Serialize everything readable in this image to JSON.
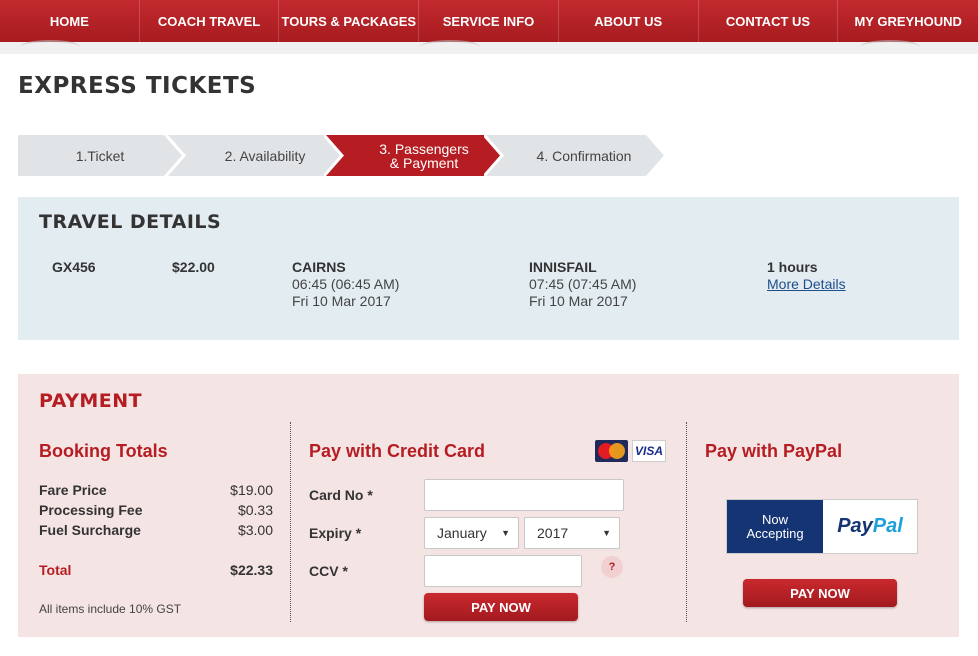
{
  "nav": {
    "items": [
      "HOME",
      "COACH TRAVEL",
      "TOURS & PACKAGES",
      "SERVICE INFO",
      "ABOUT US",
      "CONTACT US",
      "MY GREYHOUND"
    ]
  },
  "page_title": "EXPRESS TICKETS",
  "steps": [
    {
      "label": "1.Ticket",
      "active": false
    },
    {
      "label": "2. Availability",
      "active": false
    },
    {
      "label_line1": "3. Passengers",
      "label_line2": "& Payment",
      "active": true
    },
    {
      "label": "4. Confirmation",
      "active": false
    }
  ],
  "travel": {
    "title": "TRAVEL DETAILS",
    "service": "GX456",
    "price": "$22.00",
    "from": {
      "city": "CAIRNS",
      "time": "06:45 (06:45 AM)",
      "date": "Fri 10 Mar 2017"
    },
    "to": {
      "city": "INNISFAIL",
      "time": "07:45 (07:45 AM)",
      "date": "Fri 10 Mar 2017"
    },
    "duration": "1 hours",
    "more_details": "More Details"
  },
  "payment": {
    "title": "PAYMENT",
    "totals": {
      "title": "Booking Totals",
      "rows": [
        {
          "label": "Fare Price",
          "amount": "$19.00"
        },
        {
          "label": "Processing Fee",
          "amount": "$0.33"
        },
        {
          "label": "Fuel Surcharge",
          "amount": "$3.00"
        }
      ],
      "total_label": "Total",
      "total_amount": "$22.33",
      "note": "All items include 10% GST"
    },
    "card": {
      "title": "Pay with Credit Card",
      "card_no_label": "Card No *",
      "card_no_value": "",
      "expiry_label": "Expiry *",
      "expiry_month": "January",
      "expiry_year": "2017",
      "ccv_label": "CCV *",
      "ccv_value": "",
      "help": "?",
      "mastercard_text": "MasterCard",
      "visa_text": "VISA",
      "pay_button": "PAY NOW"
    },
    "paypal": {
      "title": "Pay with PayPal",
      "badge_line1": "Now",
      "badge_line2": "Accepting",
      "brand_pay": "Pay",
      "brand_pal": "Pal",
      "pay_button": "PAY NOW"
    }
  },
  "colors": {
    "brand_red": "#b51d22",
    "nav_red": "#c22a2e",
    "travel_bg": "#e3ecf1",
    "payment_bg": "#f5e4e4",
    "step_inactive": "#e1e4e7"
  }
}
